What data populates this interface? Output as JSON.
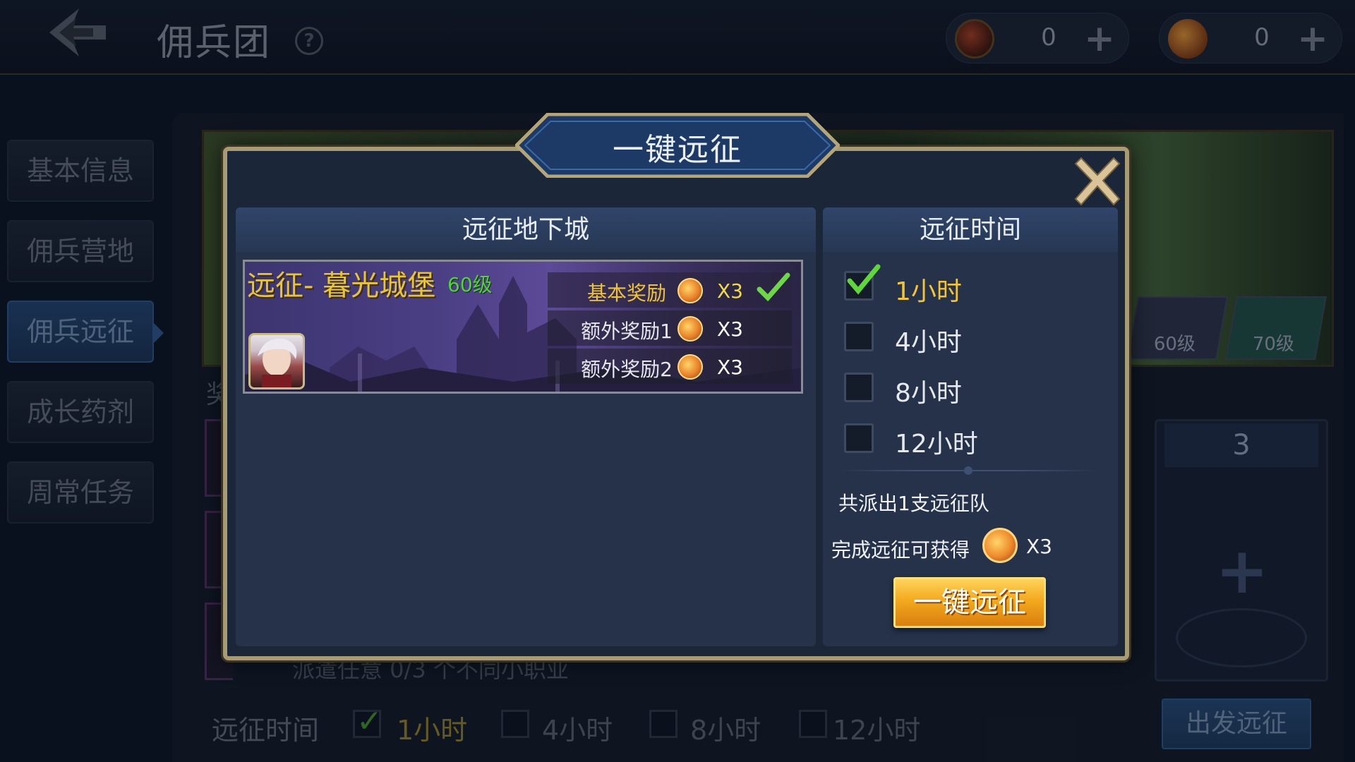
{
  "header": {
    "title": "佣兵团",
    "help_symbol": "?",
    "currency_1": {
      "icon": "dragon-emblem-icon",
      "value": "0",
      "plus": "+"
    },
    "currency_2": {
      "icon": "amber-gem-icon",
      "value": "0",
      "plus": "+"
    }
  },
  "sidebar": {
    "items": [
      {
        "label": "基本信息"
      },
      {
        "label": "佣兵营地"
      },
      {
        "label": "佣兵远征",
        "active": true
      },
      {
        "label": "成长药剂"
      },
      {
        "label": "周常任务"
      }
    ]
  },
  "background": {
    "thumb_levels": [
      "60级",
      "70级"
    ],
    "slot_count": "3",
    "side_label": "奖",
    "dispatch_hint": "派遣任意 0/3 个不同小职业",
    "time_label": "远征时间",
    "time_options": [
      "1小时",
      "4小时",
      "8小时",
      "12小时"
    ],
    "depart_button": "出发远征"
  },
  "modal": {
    "title": "一键远征",
    "left_header": "远征地下城",
    "right_header": "远征时间",
    "dungeon": {
      "name": "远征- 暮光城堡",
      "level": "60级",
      "rewards": [
        {
          "label": "基本奖励",
          "qty": "X3",
          "checked": true
        },
        {
          "label": "额外奖励1",
          "qty": "X3"
        },
        {
          "label": "额外奖励2",
          "qty": "X3"
        }
      ]
    },
    "time_options": [
      {
        "label": "1小时",
        "selected": true
      },
      {
        "label": "4小时"
      },
      {
        "label": "8小时"
      },
      {
        "label": "12小时"
      }
    ],
    "team_count": "共派出1支远征队",
    "reward_summary_label": "完成远征可获得",
    "reward_summary_qty": "X3",
    "confirm_button": "一键远征"
  },
  "colors": {
    "accent_gold": "#f1c43b",
    "level_green": "#52d33a",
    "button_orange": "#f3a91f",
    "modal_border": "#a89a73"
  }
}
